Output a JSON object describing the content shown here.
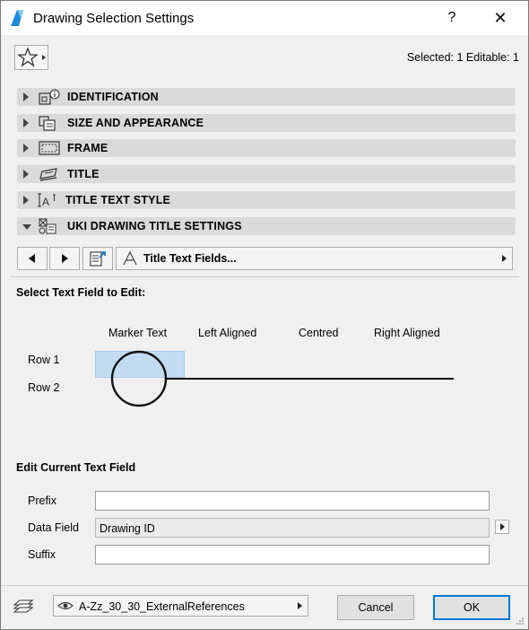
{
  "window": {
    "title": "Drawing Selection Settings",
    "help": "?",
    "close": "✕"
  },
  "selection": {
    "info": "Selected: 1 Editable: 1"
  },
  "panels": [
    {
      "label": "IDENTIFICATION",
      "icon": "identification-icon",
      "expanded": false
    },
    {
      "label": "SIZE AND APPEARANCE",
      "icon": "size-appearance-icon",
      "expanded": false
    },
    {
      "label": "FRAME",
      "icon": "frame-icon",
      "expanded": false
    },
    {
      "label": "TITLE",
      "icon": "title-icon",
      "expanded": false
    },
    {
      "label": "TITLE TEXT STYLE",
      "icon": "text-style-icon",
      "expanded": false
    },
    {
      "label": "UKI DRAWING TITLE SETTINGS",
      "icon": "title-settings-icon",
      "expanded": true
    }
  ],
  "toolbar": {
    "dropdown_label": "Title Text Fields..."
  },
  "select_section": {
    "title": "Select Text Field to Edit:",
    "columns": [
      "Marker Text",
      "Left Aligned",
      "Centred",
      "Right Aligned"
    ],
    "rows": [
      "Row 1",
      "Row 2"
    ],
    "selected_cell": "Marker Text / Row 1"
  },
  "edit_section": {
    "title": "Edit Current Text Field",
    "prefix_label": "Prefix",
    "prefix_value": "",
    "data_field_label": "Data Field",
    "data_field_value": "Drawing ID",
    "suffix_label": "Suffix",
    "suffix_value": ""
  },
  "footer": {
    "layer": "A-Zz_30_30_ExternalReferences",
    "cancel_label": "Cancel",
    "ok_label": "OK"
  },
  "colors": {
    "selection_highlight": "#c3dcf2",
    "accent": "#0078d7",
    "panel_header": "#dadada"
  }
}
